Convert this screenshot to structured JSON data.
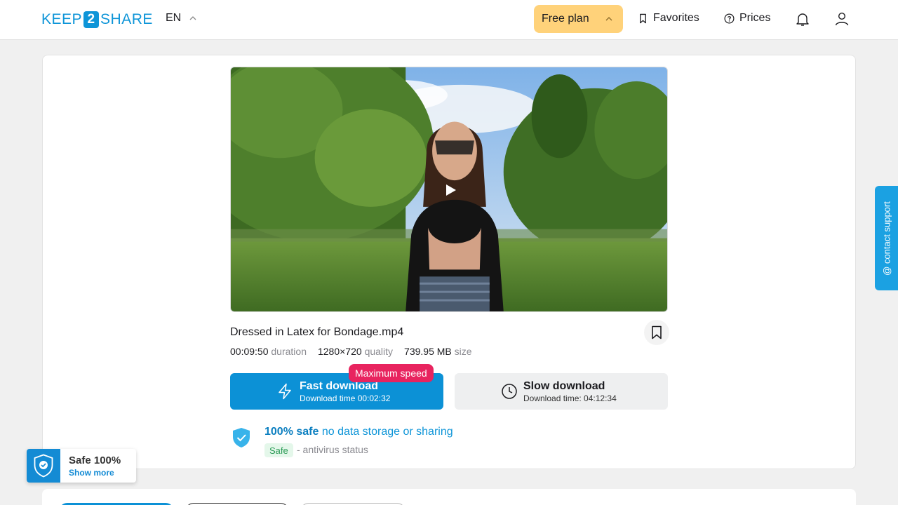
{
  "header": {
    "logo_left": "KEEP",
    "logo_mid": "2",
    "logo_right": "SHARE",
    "language": "EN",
    "plan_label": "Free plan",
    "favorites_label": "Favorites",
    "prices_label": "Prices"
  },
  "file": {
    "name": "Dressed in Latex for Bondage.mp4",
    "duration_value": "00:09:50",
    "duration_label": "duration",
    "quality_value": "1280×720",
    "quality_label": "quality",
    "size_value": "739.95 MB",
    "size_label": "size"
  },
  "download": {
    "badge": "Maximum speed",
    "fast_title": "Fast download",
    "fast_time": "Download time 00:02:32",
    "slow_title": "Slow download",
    "slow_time": "Download time: 04:12:34"
  },
  "safety": {
    "headline_bold": "100% safe",
    "headline_rest": "no data storage or sharing",
    "tag": "Safe",
    "status": "- antivirus status"
  },
  "support": {
    "label": "@ contact support"
  },
  "widget": {
    "title": "Safe 100%",
    "link": "Show more"
  },
  "colors": {
    "brand": "#0e95d8",
    "plan": "#ffd27a",
    "badge": "#e8245f",
    "safe_tag_bg": "#e4f7ea"
  }
}
